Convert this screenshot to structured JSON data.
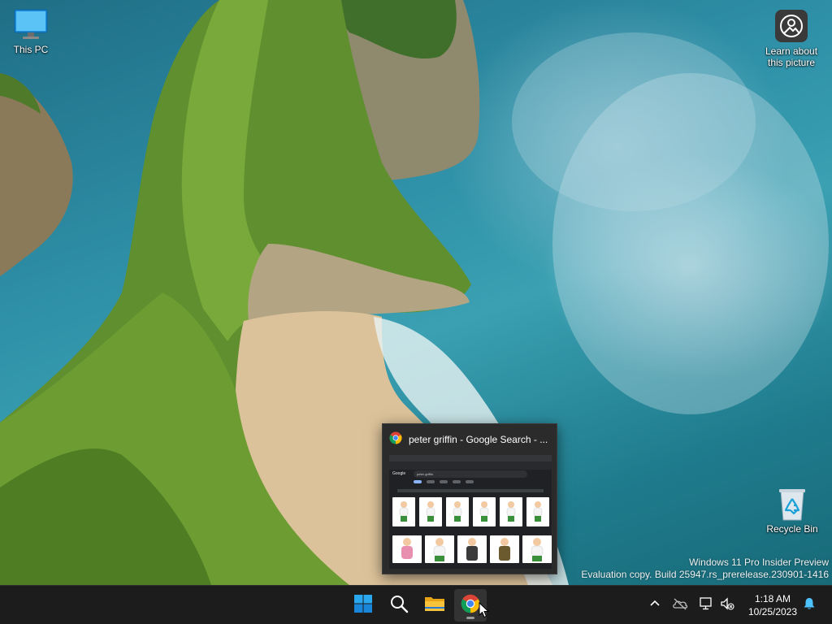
{
  "desktop": {
    "icons": [
      {
        "label": "This PC",
        "icon": "monitor-icon"
      },
      {
        "label": "Learn about this picture",
        "label_line1": "Learn about",
        "label_line2": "this picture",
        "icon": "camera-circle-icon"
      },
      {
        "label": "Recycle Bin",
        "icon": "recycle-bin-icon"
      }
    ],
    "watermark": {
      "line1": "Windows 11 Pro Insider Preview",
      "line2": "Evaluation copy. Build 25947.rs_prerelease.230901-1416"
    }
  },
  "preview": {
    "title": "peter griffin - Google Search - ...",
    "icon": "chrome-icon",
    "thumbnail": {
      "logo": "Google",
      "query": "peter griffin"
    }
  },
  "taskbar": {
    "items": [
      {
        "name": "Start",
        "icon": "windows-logo-icon"
      },
      {
        "name": "Search",
        "icon": "search-icon"
      },
      {
        "name": "File Explorer",
        "icon": "folder-icon"
      },
      {
        "name": "Google Chrome",
        "icon": "chrome-icon",
        "active": true
      }
    ],
    "tray": {
      "icons": [
        "chevron-up-icon",
        "onedrive-icon",
        "network-icon",
        "volume-muted-icon",
        "bell-icon"
      ],
      "time": "1:18 AM",
      "date": "10/25/2023"
    }
  },
  "colors": {
    "taskbar_bg": "#1c1c1c",
    "accent": "#0078d4",
    "explorer_yellow": "#f8c33b"
  }
}
